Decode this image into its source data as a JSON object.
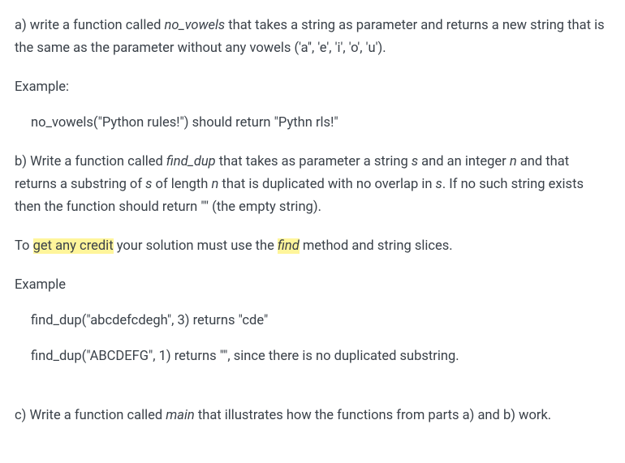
{
  "a": {
    "prefix": "a) write a function called ",
    "fn": "no_vowels",
    "suffix": " that takes a string as parameter and returns a new string that is the same as the parameter without any vowels ('a'', 'e', 'i', 'o', 'u')."
  },
  "example_label": "Example:",
  "example_a": "no_vowels(\"Python rules!\") should return \"Pythn rls!\"",
  "b": {
    "p1": "b) Write a function called ",
    "fn": "find_dup",
    "p2": " that takes as parameter a string ",
    "var_s": "s",
    "p3": " and an integer ",
    "var_n": "n",
    "p4": " and that returns a substring of ",
    "p5": " of length ",
    "p6": " that is duplicated with no overlap in ",
    "p7": ". If no such string exists then the function should return \"\" (the empty string)."
  },
  "credit": {
    "p1": "To ",
    "hl1": "get any credit",
    "p2": " your solution must use the ",
    "hl2_fn": "find",
    "p3": " method and string slices."
  },
  "example_label_b": "Example",
  "example_b1": "find_dup(\"abcdefcdegh\", 3) returns \"cde\"",
  "example_b2": "find_dup(\"ABCDEFG\", 1) returns \"\", since there is no duplicated substring.",
  "c": {
    "p1": "c) Write a function called ",
    "fn": "main",
    "p2": " that illustrates how the functions from parts a) and b) work."
  }
}
